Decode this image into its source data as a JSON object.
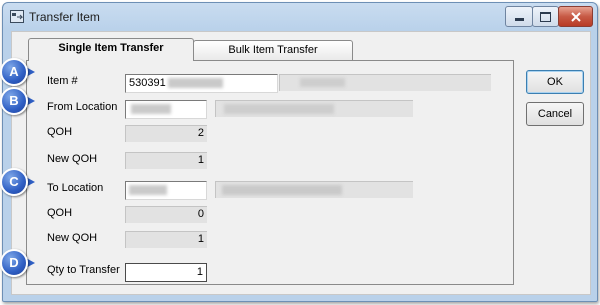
{
  "window": {
    "title": "Transfer Item"
  },
  "tabs": [
    {
      "label": "Single Item Transfer"
    },
    {
      "label": "Bulk Item Transfer"
    }
  ],
  "form": {
    "item_label": "Item #",
    "item_value": "530391",
    "from_location_label": "From Location",
    "from_qoh_label": "QOH",
    "from_qoh_value": "2",
    "from_new_qoh_label": "New QOH",
    "from_new_qoh_value": "1",
    "to_location_label": "To Location",
    "to_qoh_label": "QOH",
    "to_qoh_value": "0",
    "to_new_qoh_label": "New QOH",
    "to_new_qoh_value": "1",
    "qty_label": "Qty to Transfer",
    "qty_value": "1"
  },
  "buttons": {
    "ok": "OK",
    "cancel": "Cancel"
  },
  "callouts": [
    "A",
    "B",
    "C",
    "D"
  ],
  "colors": {
    "callout": "#2f5fc4",
    "close_button": "#c75a45"
  }
}
